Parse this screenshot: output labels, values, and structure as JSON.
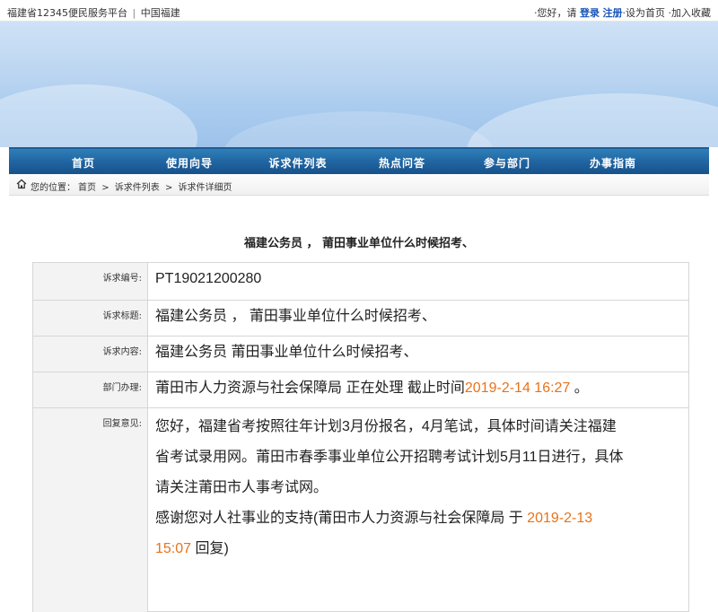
{
  "topbar": {
    "site_title": "福建省12345便民服务平台",
    "separator": "|",
    "site_sub": "中国福建",
    "greeting": "您好，请",
    "login": "登录",
    "register": "注册",
    "set_home": "设为首页",
    "add_fav": "加入收藏",
    "dot": "·"
  },
  "nav": {
    "items": [
      "首页",
      "使用向导",
      "诉求件列表",
      "热点问答",
      "参与部门",
      "办事指南"
    ]
  },
  "breadcrumb": {
    "prefix": "您的位置：",
    "home": "首页",
    "sep": ">",
    "list": "诉求件列表",
    "detail": "诉求件详细页"
  },
  "title": "福建公务员 ， 莆田事业单位什么时候招考、",
  "detail": {
    "id_label": "诉求编号:",
    "id_value": "PT19021200280",
    "title_label": "诉求标题:",
    "title_value": "福建公务员 ， 莆田事业单位什么时候招考、",
    "content_label": "诉求内容:",
    "content_value": "福建公务员 莆田事业单位什么时候招考、",
    "dept_label": "部门办理:",
    "dept_value_a": "莆田市人力资源与社会保障局 正在处理 截止时间",
    "dept_deadline": "2019-2-14 16:27",
    "dept_value_b": " 。",
    "reply_label": "回复意见:",
    "reply_line1": "您好，福建省考按照往年计划3月份报名，4月笔试，具体时间请关注福建",
    "reply_line2": "省考试录用网。莆田市春季事业单位公开招聘考试计划5月11日进行，具体",
    "reply_line3": "请关注莆田市人事考试网。",
    "reply_line4a": "感谢您对人社事业的支持(莆田市人力资源与社会保障局 于 ",
    "reply_date1": "2019-2-13",
    "reply_date2": "15:07",
    "reply_line5b": " 回复)"
  },
  "colors": {
    "nav_blue": "#1f63a0",
    "accent_orange": "#e8731a",
    "link_blue": "#1a56b8"
  }
}
